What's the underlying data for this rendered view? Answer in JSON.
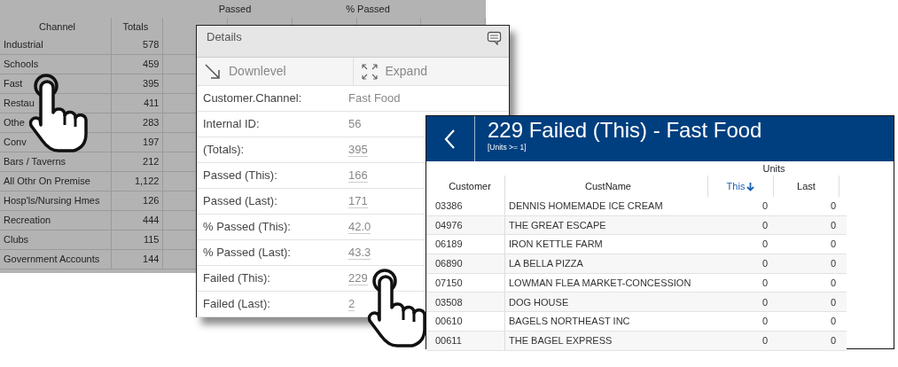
{
  "background_table": {
    "group_headers": [
      {
        "label": "Passed"
      },
      {
        "label": "% Passed"
      }
    ],
    "columns": [
      "Channel",
      "Totals"
    ],
    "rows": [
      {
        "channel": "Industrial",
        "totals": "578"
      },
      {
        "channel": "Schools",
        "totals": "459"
      },
      {
        "channel": "Fast",
        "totals": "395"
      },
      {
        "channel": "Restau",
        "totals": "411"
      },
      {
        "channel": "Othe",
        "totals": "283"
      },
      {
        "channel": "Conv",
        "totals": "197"
      },
      {
        "channel": "Bars / Taverns",
        "totals": "212"
      },
      {
        "channel": "All Othr On Premise",
        "totals": "1,122"
      },
      {
        "channel": "Hosp'ls/Nursing Hmes",
        "totals": "126"
      },
      {
        "channel": "Recreation",
        "totals": "444"
      },
      {
        "channel": "Clubs",
        "totals": "115"
      },
      {
        "channel": "Government Accounts",
        "totals": "144"
      }
    ]
  },
  "details_panel": {
    "title": "Details",
    "actions": [
      {
        "label": "Downlevel",
        "kind": "downlevel"
      },
      {
        "label": "Expand",
        "kind": "expand"
      }
    ],
    "fields": [
      {
        "label": "Customer.Channel:",
        "value": "Fast Food",
        "linked": false
      },
      {
        "label": "Internal ID:",
        "value": "56",
        "linked": false
      },
      {
        "label": "(Totals):",
        "value": "395",
        "linked": true
      },
      {
        "label": "Passed (This):",
        "value": "166",
        "linked": true
      },
      {
        "label": "Passed (Last):",
        "value": "171",
        "linked": true
      },
      {
        "label": "% Passed (This):",
        "value": "42.0",
        "linked": true
      },
      {
        "label": "% Passed (Last):",
        "value": "43.3",
        "linked": true
      },
      {
        "label": "Failed (This):",
        "value": "229",
        "linked": true
      },
      {
        "label": "Failed (Last):",
        "value": "2",
        "linked": true
      }
    ]
  },
  "drill_panel": {
    "title": "229 Failed (This) - Fast Food",
    "subtitle": "[Units >= 1]",
    "group_header": "Units",
    "columns": [
      {
        "label": "Customer",
        "sorted": false
      },
      {
        "label": "CustName",
        "sorted": false
      },
      {
        "label": "This",
        "sorted": true
      },
      {
        "label": "Last",
        "sorted": false
      }
    ],
    "rows": [
      [
        "03386",
        "DENNIS HOMEMADE ICE CREAM",
        "0",
        "0"
      ],
      [
        "04976",
        "THE GREAT ESCAPE",
        "0",
        "0"
      ],
      [
        "06189",
        "IRON KETTLE FARM",
        "0",
        "0"
      ],
      [
        "06890",
        "LA BELLA PIZZA",
        "0",
        "0"
      ],
      [
        "07150",
        "LOWMAN FLEA MARKET-CONCESSION",
        "0",
        "0"
      ],
      [
        "03508",
        "DOG HOUSE",
        "0",
        "0"
      ],
      [
        "00610",
        "BAGELS NORTHEAST INC",
        "0",
        "0"
      ],
      [
        "00611",
        "THE BAGEL EXPRESS",
        "0",
        "0"
      ]
    ]
  }
}
